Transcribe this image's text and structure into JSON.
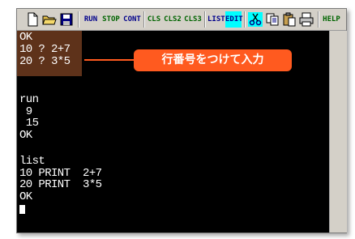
{
  "toolbar": {
    "icons": [
      "new-file-icon",
      "open-folder-icon",
      "save-disk-icon"
    ],
    "run": "RUN",
    "stop": "STOP",
    "cont": "CONT",
    "cls": "CLS",
    "cls2": "CLS2",
    "cls3": "CLS3",
    "list": "LIST",
    "edit": "EDIT",
    "cut_icon": "scissors-icon",
    "copy_icon": "copy-icon",
    "paste_icon": "paste-icon",
    "print_icon": "printer-icon",
    "help": "HELP"
  },
  "colors": {
    "run_color": "#00008b",
    "stop_color": "#006400",
    "cls_color": "#006400",
    "list_color": "#00008b",
    "edit_bg": "#00ffff",
    "callout_bg": "#ff5a1f",
    "highlight_bg": "#6e3b1f"
  },
  "screen": {
    "lines": [
      "OK",
      "10 ? 2+7",
      "20 ? 3*5",
      "",
      "run",
      " 9",
      " 15",
      "OK",
      "",
      "list",
      "10 PRINT  2+7",
      "20 PRINT  3*5",
      "OK"
    ]
  },
  "callout": {
    "text": "行番号をつけて入力"
  }
}
